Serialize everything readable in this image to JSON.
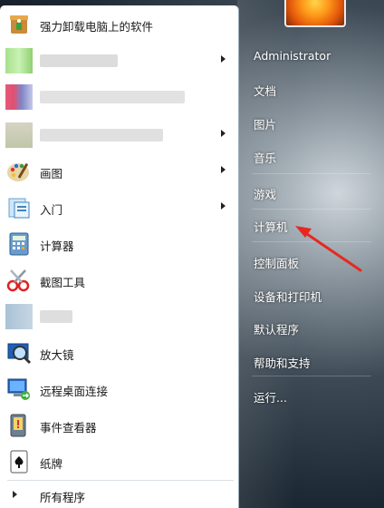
{
  "left_panel": {
    "items": [
      {
        "label": "强力卸载电脑上的软件",
        "icon": "uninstall-box-icon",
        "has_arrow": false
      },
      {
        "label": "",
        "icon": "blurred-icon",
        "has_arrow": true
      },
      {
        "label": "",
        "icon": "blurred-icon",
        "has_arrow": false
      },
      {
        "label": "",
        "icon": "blurred-icon",
        "has_arrow": true
      },
      {
        "label": "画图",
        "icon": "paint-palette-icon",
        "has_arrow": true
      },
      {
        "label": "入门",
        "icon": "getting-started-icon",
        "has_arrow": true
      },
      {
        "label": "计算器",
        "icon": "calculator-icon",
        "has_arrow": false
      },
      {
        "label": "截图工具",
        "icon": "scissors-icon",
        "has_arrow": false
      },
      {
        "label": "",
        "icon": "blurred-icon",
        "has_arrow": false
      },
      {
        "label": "放大镜",
        "icon": "magnifier-icon",
        "has_arrow": false
      },
      {
        "label": "远程桌面连接",
        "icon": "remote-desktop-icon",
        "has_arrow": false
      },
      {
        "label": "事件查看器",
        "icon": "event-viewer-icon",
        "has_arrow": false
      },
      {
        "label": "纸牌",
        "icon": "solitaire-card-icon",
        "has_arrow": false
      }
    ],
    "all_programs": "所有程序"
  },
  "right_panel": {
    "user": "Administrator",
    "items": [
      "文档",
      "图片",
      "音乐",
      "游戏",
      "计算机",
      "控制面板",
      "设备和打印机",
      "默认程序",
      "帮助和支持",
      "运行..."
    ]
  },
  "colors": {
    "annotation_arrow": "#e8281f",
    "panel_bg": "#ffffff",
    "glass_dark": "#1b2732"
  }
}
